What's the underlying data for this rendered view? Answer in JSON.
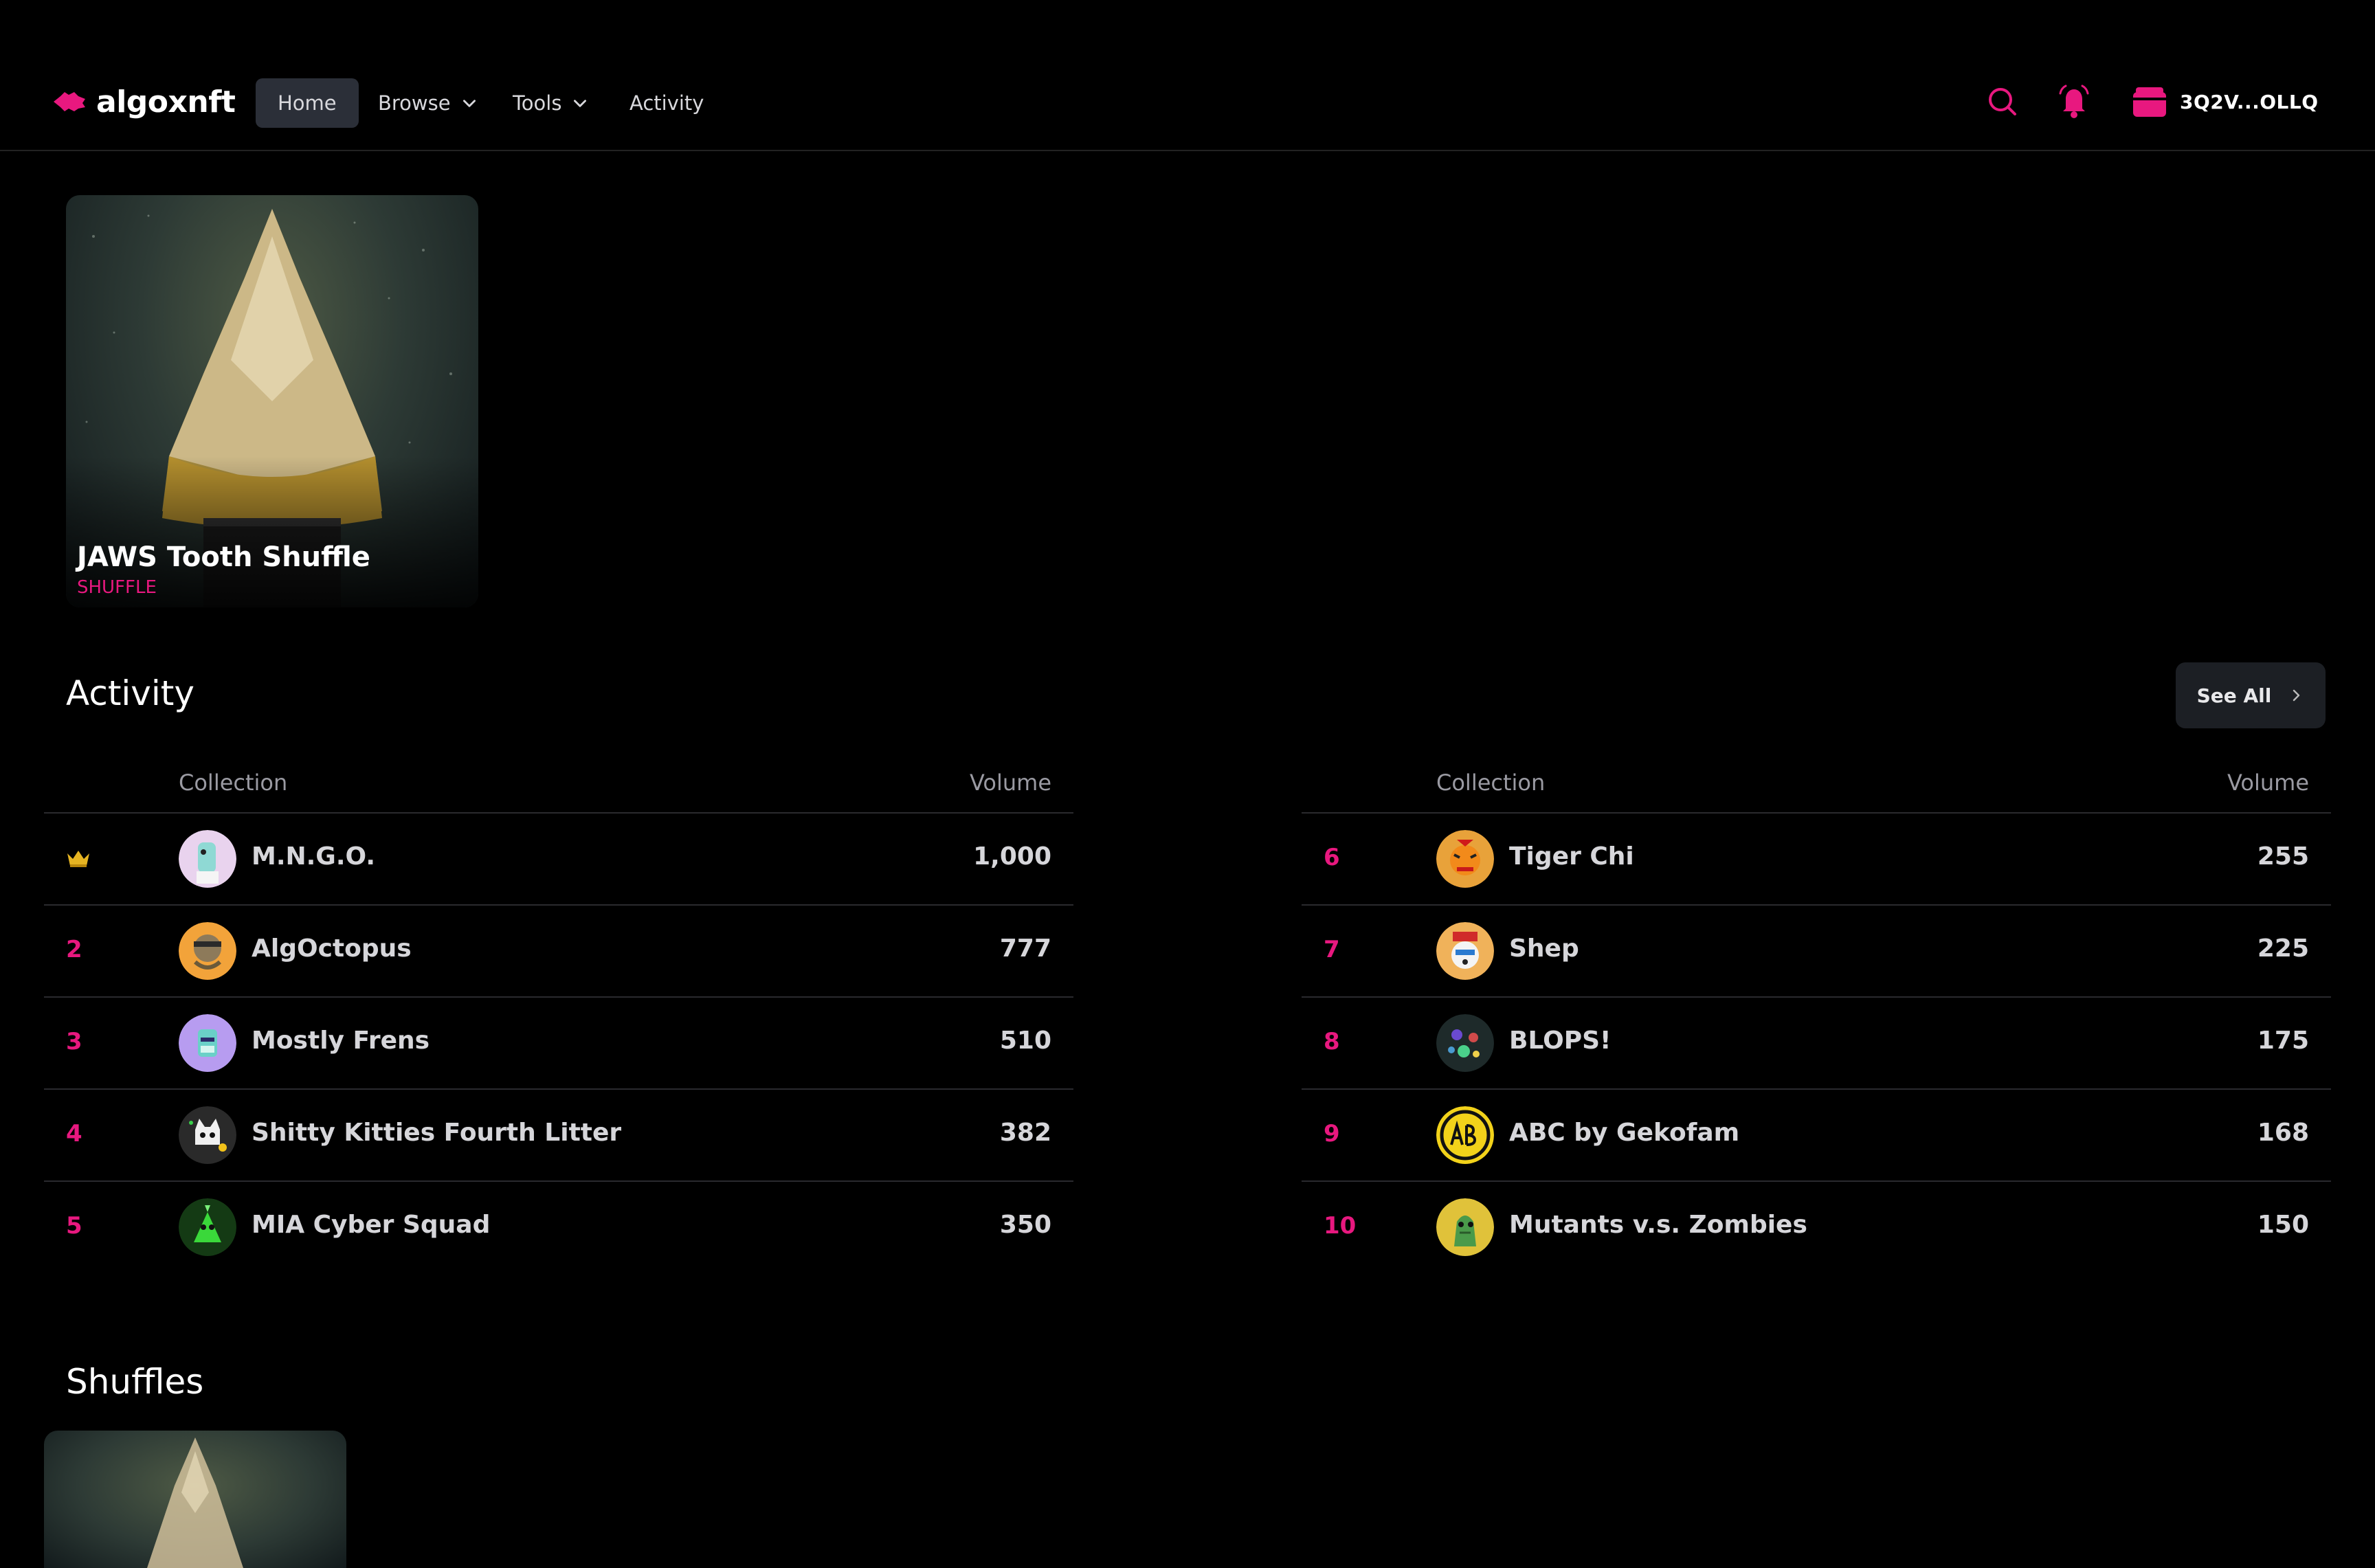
{
  "nav": {
    "brand": "algoxnft",
    "items": [
      {
        "label": "Home",
        "active": true
      },
      {
        "label": "Browse",
        "dropdown": true
      },
      {
        "label": "Tools",
        "dropdown": true
      },
      {
        "label": "Activity"
      }
    ],
    "wallet_address": "3Q2V...OLLQ",
    "accent_color": "#e8187f"
  },
  "featured": {
    "title": "JAWS Tooth Shuffle",
    "subtitle": "SHUFFLE"
  },
  "activity": {
    "title": "Activity",
    "see_all_label": "See All",
    "columns": {
      "collection": "Collection",
      "volume": "Volume"
    },
    "left_rows": [
      {
        "rank": "1",
        "crown": true,
        "name": "M.N.G.O.",
        "volume": "1,000",
        "avatar_color": "#e9d3ee"
      },
      {
        "rank": "2",
        "name": "AlgOctopus",
        "volume": "777",
        "avatar_color": "#f2a33a"
      },
      {
        "rank": "3",
        "name": "Mostly Frens",
        "volume": "510",
        "avatar_color": "#b79cf0"
      },
      {
        "rank": "4",
        "name": "Shitty Kitties Fourth Litter",
        "volume": "382",
        "avatar_color": "#2a2a2a"
      },
      {
        "rank": "5",
        "name": "MIA Cyber Squad",
        "volume": "350",
        "avatar_color": "#143a14"
      }
    ],
    "right_rows": [
      {
        "rank": "6",
        "name": "Tiger Chi",
        "volume": "255",
        "avatar_color": "#e8a23a"
      },
      {
        "rank": "7",
        "name": "Shep",
        "volume": "225",
        "avatar_color": "#f0b25a"
      },
      {
        "rank": "8",
        "name": "BLOPS!",
        "volume": "175",
        "avatar_color": "#1e2a2a"
      },
      {
        "rank": "9",
        "name": "ABC by Gekofam",
        "volume": "168",
        "avatar_color": "#f2d21a"
      },
      {
        "rank": "10",
        "name": "Mutants v.s. Zombies",
        "volume": "150",
        "avatar_color": "#e0c23a"
      }
    ]
  },
  "shuffles": {
    "title": "Shuffles"
  }
}
